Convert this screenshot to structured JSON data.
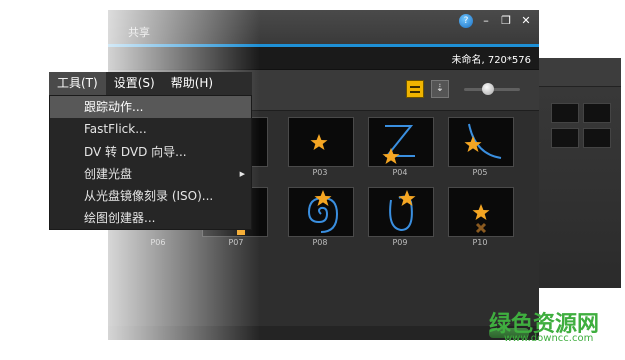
{
  "window": {
    "tab_share": "共享",
    "project_info": "未命名, 720*576",
    "help_glyph": "?",
    "minimize_glyph": "–",
    "maximize_glyph": "❐",
    "close_glyph": "✕"
  },
  "menubar": {
    "items": [
      {
        "label": "工具(T)"
      },
      {
        "label": "设置(S)"
      },
      {
        "label": "帮助(H)"
      }
    ]
  },
  "tools_menu": {
    "items": [
      {
        "label": "跟踪动作..."
      },
      {
        "label": "FastFlick..."
      },
      {
        "label": "DV 转 DVD 向导..."
      },
      {
        "label": "创建光盘"
      },
      {
        "label": "从光盘镜像刻录 (ISO)..."
      },
      {
        "label": "绘图创建器..."
      }
    ],
    "highlighted_index": 0,
    "submenu_arrow_glyph": "▶"
  },
  "library": {
    "thumbnails": [
      {
        "label": "P03"
      },
      {
        "label": "P04"
      },
      {
        "label": "P05"
      },
      {
        "label": "P06"
      },
      {
        "label": "P07"
      },
      {
        "label": "P08"
      },
      {
        "label": "P09"
      },
      {
        "label": "P10"
      }
    ]
  },
  "watermark": {
    "main": "绿色资源网",
    "url": "www.downcc.com"
  },
  "colors": {
    "accent": "#1e90d6",
    "star": "#f5a623",
    "path": "#3a8fe0",
    "watermark": "#3fae3f",
    "highlight": "#585858"
  },
  "icons": [
    "help-icon",
    "minimize-icon",
    "maximize-icon",
    "close-icon",
    "storyboard-view-icon",
    "sort-icon",
    "zoom-slider",
    "submenu-arrow-icon"
  ]
}
